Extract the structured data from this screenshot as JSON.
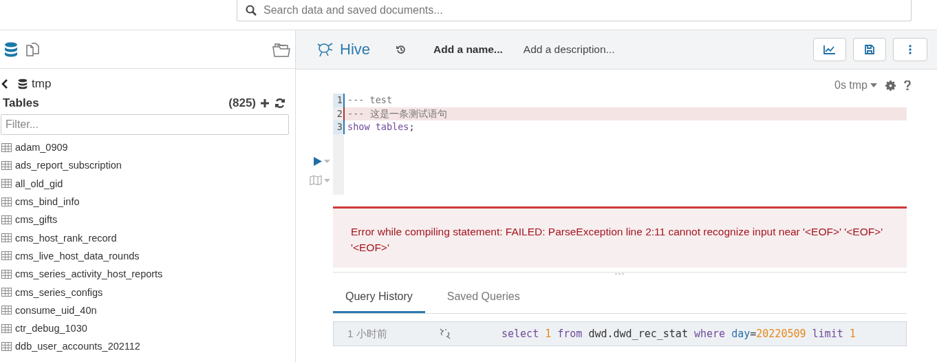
{
  "search": {
    "placeholder": "Search data and saved documents..."
  },
  "sidebar": {
    "database": "tmp",
    "section_title": "Tables",
    "count": "(825)",
    "filter": {
      "placeholder": "Filter..."
    },
    "tables": [
      "adam_0909",
      "ads_report_subscription",
      "all_old_gid",
      "cms_bind_info",
      "cms_gifts",
      "cms_host_rank_record",
      "cms_live_host_data_rounds",
      "cms_series_activity_host_reports",
      "cms_series_configs",
      "consume_uid_40n",
      "ctr_debug_1030",
      "ddb_user_accounts_202112"
    ]
  },
  "editor": {
    "app_name": "Hive",
    "name_placeholder": "Add a name...",
    "description_placeholder": "Add a description...",
    "status": "0s tmp",
    "lines": [
      {
        "number": "1",
        "error": false,
        "tokens": [
          {
            "text": "--- test",
            "kind": "comment"
          }
        ]
      },
      {
        "number": "2",
        "error": true,
        "tokens": [
          {
            "text": "--- 这是一条测试语句",
            "kind": "comment"
          }
        ]
      },
      {
        "number": "3",
        "error": false,
        "tokens": [
          {
            "text": "show tables",
            "kind": "keyword"
          },
          {
            "text": ";",
            "kind": "plain"
          }
        ]
      }
    ],
    "error_message": "Error while compiling statement: FAILED: ParseException line 2:11 cannot recognize input near '<EOF>' '<EOF>' '<EOF>'"
  },
  "history": {
    "tabs": [
      {
        "label": "Query History",
        "selected": true
      },
      {
        "label": "Saved Queries",
        "selected": false
      }
    ],
    "rows": [
      {
        "time": "1 小时前",
        "tokens": [
          {
            "text": "select ",
            "kind": "keyword"
          },
          {
            "text": "1 ",
            "kind": "number"
          },
          {
            "text": "from ",
            "kind": "keyword"
          },
          {
            "text": "dwd.dwd_rec_stat ",
            "kind": "plain"
          },
          {
            "text": "where ",
            "kind": "keyword"
          },
          {
            "text": "day",
            "kind": "variable"
          },
          {
            "text": "=",
            "kind": "plain"
          },
          {
            "text": "20220509 ",
            "kind": "number"
          },
          {
            "text": "limit ",
            "kind": "keyword"
          },
          {
            "text": "1",
            "kind": "number"
          }
        ]
      }
    ]
  }
}
